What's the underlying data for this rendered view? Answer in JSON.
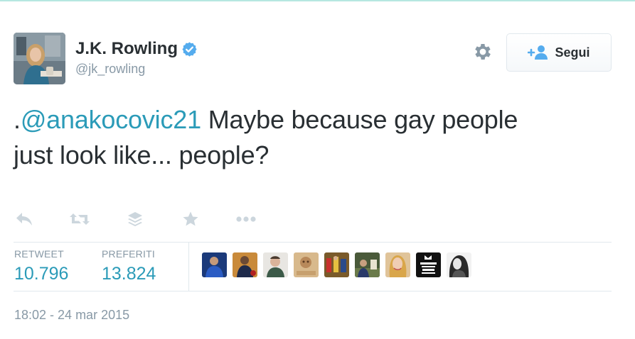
{
  "profile": {
    "display_name": "J.K. Rowling",
    "handle": "@jk_rowling",
    "verified": true,
    "avatar_icon": "avatar-photo"
  },
  "header_actions": {
    "settings_icon": "gear-icon",
    "follow_icon": "add-user-icon",
    "follow_label": "Segui"
  },
  "tweet": {
    "prefix": ".",
    "mention": "@anakocovic21",
    "text": " Maybe because gay people just look like... people?"
  },
  "actions": [
    {
      "name": "reply",
      "icon": "reply-icon"
    },
    {
      "name": "retweet",
      "icon": "retweet-icon"
    },
    {
      "name": "buffer",
      "icon": "layers-icon"
    },
    {
      "name": "favorite",
      "icon": "star-icon"
    },
    {
      "name": "more",
      "icon": "more-icon"
    }
  ],
  "stats": {
    "retweets_label": "RETWEET",
    "retweets_value": "10.796",
    "favorites_label": "PREFERITI",
    "favorites_value": "13.824"
  },
  "favoriters": [
    {
      "icon": "user-avatar-1"
    },
    {
      "icon": "user-avatar-2"
    },
    {
      "icon": "user-avatar-3"
    },
    {
      "icon": "user-avatar-4"
    },
    {
      "icon": "user-avatar-5"
    },
    {
      "icon": "user-avatar-6"
    },
    {
      "icon": "user-avatar-7"
    },
    {
      "icon": "user-avatar-8"
    },
    {
      "icon": "user-avatar-9"
    }
  ],
  "timestamp": "18:02 - 24 mar 2015",
  "colors": {
    "link": "#2b9bb8",
    "muted": "#8899a6",
    "text": "#292f33",
    "verified": "#55acee",
    "icon": "#ccd6dd"
  }
}
